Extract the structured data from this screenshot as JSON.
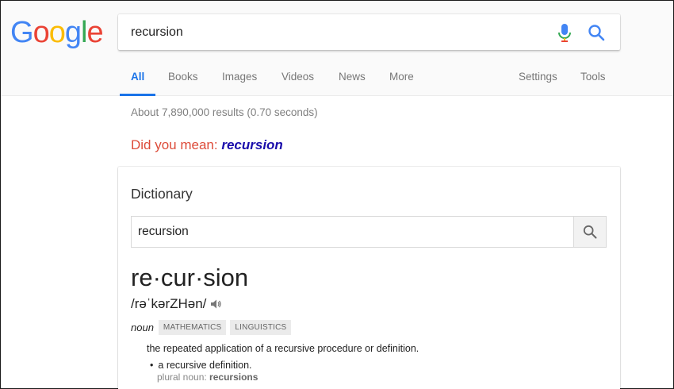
{
  "logo": {
    "letters": [
      "G",
      "o",
      "o",
      "g",
      "l",
      "e"
    ],
    "colors": [
      "#4285f4",
      "#ea4335",
      "#fbbc05",
      "#4285f4",
      "#34a853",
      "#ea4335"
    ]
  },
  "search": {
    "query": "recursion"
  },
  "tabs": [
    {
      "label": "All",
      "active": true
    },
    {
      "label": "Books"
    },
    {
      "label": "Images"
    },
    {
      "label": "Videos"
    },
    {
      "label": "News"
    },
    {
      "label": "More"
    },
    {
      "label": "Settings"
    },
    {
      "label": "Tools"
    }
  ],
  "results": {
    "stats": "About 7,890,000 results (0.70 seconds)",
    "did_you_mean_prefix": "Did you mean: ",
    "did_you_mean_term": "recursion"
  },
  "dictionary": {
    "title": "Dictionary",
    "query": "recursion",
    "headword": "re·cur·sion",
    "pronunciation": "/rəˈkərZHən/",
    "part_of_speech": "noun",
    "tags": [
      "MATHEMATICS",
      "LINGUISTICS"
    ],
    "definition": "the repeated application of a recursive procedure or definition.",
    "sub_definition": "a recursive definition.",
    "plural_label": "plural noun: ",
    "plural_value": "recursions"
  },
  "colors": {
    "accent": "#1a73e8",
    "link": "#1a0dab",
    "did_you_mean": "#dd4b39"
  }
}
